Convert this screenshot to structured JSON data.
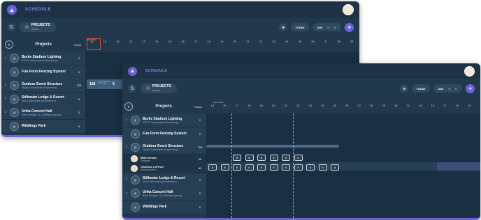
{
  "app": {
    "name": "SCHEDULE"
  },
  "toolbar": {
    "project_title": "PROJECTS",
    "project_sub": "MIDDLE",
    "today": "TODAY",
    "view_day": "DAY",
    "view_week": "W",
    "view_month": "M"
  },
  "sidebar": {
    "title": "Projects",
    "hours_label": "Hours"
  },
  "header_month": "AUG 2022",
  "days": [
    "15",
    "16",
    "17",
    "18",
    "19",
    "20",
    "21",
    "22",
    "23",
    "24",
    "25",
    "26",
    "27",
    "28",
    "29",
    "30",
    "31"
  ],
  "back_days": [
    "15",
    "16",
    "11",
    "12",
    "13",
    "14",
    "15",
    "16",
    "17",
    "18",
    "19",
    "20",
    "21",
    "22",
    "23",
    "24",
    "25",
    "26",
    "27",
    "28",
    "29"
  ],
  "projects": [
    {
      "name": "Burke Stadium Lighting",
      "sub": "GDYS, Incorporated (Technology...",
      "hours": "0"
    },
    {
      "name": "Fun Form Fencing System",
      "sub": "",
      "hours": "0"
    },
    {
      "name": "Outdoor Event Structure",
      "sub": "Ripley Consultants (Engineering...",
      "hours": "128"
    },
    {
      "name": "Stillwater Lodge & Resort",
      "sub": "Still & Associates (Architecture)",
      "hours": "0"
    },
    {
      "name": "Urika Concert Hall",
      "sub": "Bella Designs, LLC (Design Agency)",
      "hours": "0"
    },
    {
      "name": "Wildlings Park",
      "sub": "",
      "hours": "0"
    }
  ],
  "people": [
    {
      "name": "Mike Arnold",
      "role": "Designer",
      "hours": "48"
    },
    {
      "name": "Charisse LeFever",
      "role": "Administration",
      "hours": "80"
    }
  ],
  "back_bar": {
    "hours": "128",
    "label": "OUTDOOR EVENT STRUCTURE",
    "count": "6"
  },
  "cell_value": "8",
  "colors": {
    "accent": "#6a63d8",
    "panel": "#22384c",
    "today_marker": "#8fd32a"
  }
}
